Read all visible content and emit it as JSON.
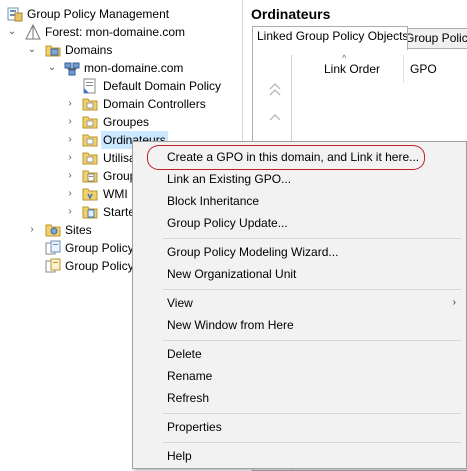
{
  "tree": {
    "items": [
      {
        "label": "Group Policy Management",
        "icon": "gpm-console-icon",
        "arrow": ""
      },
      {
        "label": "Forest: mon-domaine.com",
        "icon": "forest-icon",
        "arrow": "expanded"
      },
      {
        "label": "Domains",
        "icon": "domains-folder-icon",
        "arrow": "expanded"
      },
      {
        "label": "mon-domaine.com",
        "icon": "domain-icon",
        "arrow": "expanded"
      },
      {
        "label": "Default Domain Policy",
        "icon": "gpo-link-icon",
        "arrow": ""
      },
      {
        "label": "Domain Controllers",
        "icon": "ou-folder-icon",
        "arrow": "collapsed"
      },
      {
        "label": "Groupes",
        "icon": "ou-folder-icon",
        "arrow": "collapsed"
      },
      {
        "label": "Ordinateurs",
        "icon": "ou-folder-icon",
        "arrow": "collapsed",
        "selected": true
      },
      {
        "label": "Utilisa",
        "icon": "ou-folder-icon",
        "arrow": "collapsed"
      },
      {
        "label": "Group",
        "icon": "gpo-folder-icon",
        "arrow": "collapsed"
      },
      {
        "label": "WMI",
        "icon": "wmi-folder-icon",
        "arrow": "collapsed"
      },
      {
        "label": "Starte",
        "icon": "starter-gpo-folder-icon",
        "arrow": "collapsed"
      },
      {
        "label": "Sites",
        "icon": "sites-folder-icon",
        "arrow": "collapsed"
      },
      {
        "label": "Group Policy",
        "icon": "gp-modeling-icon",
        "arrow": ""
      },
      {
        "label": "Group Policy",
        "icon": "gp-results-icon",
        "arrow": ""
      }
    ]
  },
  "details": {
    "title": "Ordinateurs",
    "tabs": [
      {
        "label": "Linked Group Policy Objects",
        "active": true
      },
      {
        "label": "Group Policy",
        "active": false
      }
    ],
    "columns": [
      "Link Order",
      "GPO"
    ]
  },
  "context_menu": {
    "highlight_color": "#c0202a",
    "items": [
      {
        "label": "Create a GPO in this domain, and Link it here...",
        "highlighted": true
      },
      {
        "label": "Link an Existing GPO..."
      },
      {
        "label": "Block Inheritance"
      },
      {
        "label": "Group Policy Update..."
      },
      {
        "label": "Group Policy Modeling Wizard..."
      },
      {
        "label": "New Organizational Unit"
      },
      {
        "label": "View",
        "submenu": true
      },
      {
        "label": "New Window from Here"
      },
      {
        "label": "Delete"
      },
      {
        "label": "Rename"
      },
      {
        "label": "Refresh"
      },
      {
        "label": "Properties"
      },
      {
        "label": "Help"
      }
    ]
  }
}
